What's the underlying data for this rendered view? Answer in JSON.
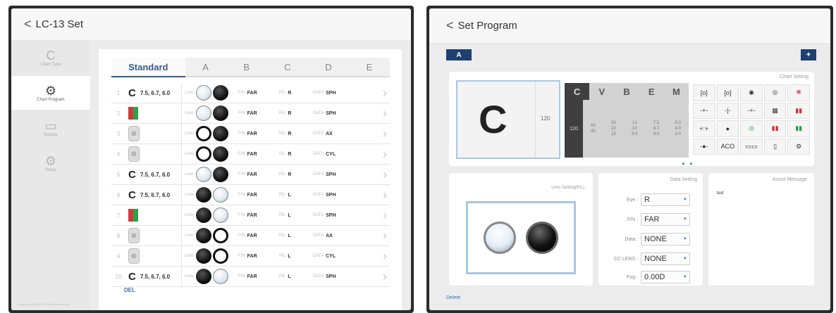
{
  "left": {
    "title": "LC-13 Set",
    "sidebar": [
      {
        "icon": "C",
        "label": "Chart Type",
        "active": false
      },
      {
        "icon": "⚙",
        "label": "Chart Program",
        "active": true
      },
      {
        "icon": "▭",
        "label": "Display",
        "active": false
      },
      {
        "icon": "⚙",
        "label": "Setup",
        "active": false
      }
    ],
    "tabs": [
      "Standard",
      "A",
      "B",
      "C",
      "D",
      "E"
    ],
    "rows": [
      {
        "num": "1",
        "chart": "C",
        "text": "7.5, 6.7, 6.0",
        "lens": "Lens",
        "l1": "white",
        "l2": "black",
        "fn_k": "F/N",
        "fn_v": "FAR",
        "rl_k": "R/L",
        "rl_v": "R",
        "data_k": "DATA",
        "data_v": "SPH"
      },
      {
        "num": "2",
        "chart": "rg",
        "text": "",
        "lens": "Lens",
        "l1": "white",
        "l2": "black",
        "fn_k": "F/N",
        "fn_v": "FAR",
        "rl_k": "R/L",
        "rl_v": "R",
        "data_k": "DATA",
        "data_v": "SPH"
      },
      {
        "num": "3",
        "chart": "fig",
        "text": "",
        "lens": "Lens",
        "l1": "ring",
        "l2": "black",
        "fn_k": "F/N",
        "fn_v": "FAR",
        "rl_k": "R/L",
        "rl_v": "R",
        "data_k": "DATA",
        "data_v": "AX"
      },
      {
        "num": "4",
        "chart": "fig",
        "text": "",
        "lens": "Lens",
        "l1": "ring",
        "l2": "black",
        "fn_k": "F/N",
        "fn_v": "FAR",
        "rl_k": "R/L",
        "rl_v": "R",
        "data_k": "DATA",
        "data_v": "CYL"
      },
      {
        "num": "5",
        "chart": "C",
        "text": "7.5, 6.7, 6.0",
        "lens": "Lens",
        "l1": "white",
        "l2": "black",
        "fn_k": "F/N",
        "fn_v": "FAR",
        "rl_k": "R/L",
        "rl_v": "R",
        "data_k": "DATA",
        "data_v": "SPH"
      },
      {
        "num": "6",
        "chart": "C",
        "text": "7.5, 6.7, 6.0",
        "lens": "Lens",
        "l1": "black",
        "l2": "white",
        "fn_k": "F/N",
        "fn_v": "FAR",
        "rl_k": "R/L",
        "rl_v": "L",
        "data_k": "DATA",
        "data_v": "SPH"
      },
      {
        "num": "7",
        "chart": "rg",
        "text": "",
        "lens": "Lens",
        "l1": "black",
        "l2": "white",
        "fn_k": "F/N",
        "fn_v": "FAR",
        "rl_k": "R/L",
        "rl_v": "L",
        "data_k": "DATA",
        "data_v": "SPH"
      },
      {
        "num": "8",
        "chart": "fig",
        "text": "",
        "lens": "Lens",
        "l1": "black",
        "l2": "ring",
        "fn_k": "F/N",
        "fn_v": "FAR",
        "rl_k": "R/L",
        "rl_v": "L",
        "data_k": "DATA",
        "data_v": "AX"
      },
      {
        "num": "9",
        "chart": "fig",
        "text": "",
        "lens": "Lens",
        "l1": "black",
        "l2": "ring",
        "fn_k": "F/N",
        "fn_v": "FAR",
        "rl_k": "R/L",
        "rl_v": "L",
        "data_k": "DATA",
        "data_v": "CYL"
      },
      {
        "num": "10",
        "chart": "C",
        "text": "7.5, 6.7, 6.0",
        "lens": "Lens",
        "l1": "black",
        "l2": "white",
        "fn_k": "F/N",
        "fn_v": "FAR",
        "rl_k": "R/L",
        "rl_v": "L",
        "data_k": "DATA",
        "data_v": "SPH"
      }
    ],
    "del_label": "DEL",
    "copyright": "Copyright (c) LUNEAU. All rights reserved."
  },
  "right": {
    "title": "Set Program",
    "program_button": "A",
    "plus_button": "+",
    "chart_setting_label": "Chart Setting",
    "preview_letter": "C",
    "preview_number": "120",
    "acuity_headers": [
      "C",
      "V",
      "B",
      "E",
      "M"
    ],
    "acuity_selected": "120",
    "acuity_cols": [
      [
        "60",
        "40"
      ],
      [
        "30",
        "20",
        "15"
      ],
      [
        "12",
        "10",
        "8.0"
      ],
      [
        "7.5",
        "6.7",
        "6.0"
      ],
      [
        "5.0",
        "4.0",
        "3.0"
      ]
    ],
    "icon_grid": [
      "[o]",
      "[o]",
      "◉",
      "◎",
      "❋",
      "-+-",
      "-|-",
      "-+-",
      "▦",
      "▮▮",
      "+:+",
      "●",
      "◎",
      "▮▮",
      "▮▮",
      "-●-",
      "ACO",
      "▭▭",
      "▯",
      "⚙"
    ],
    "lens_setting_label": "Lens Setting(R/L)",
    "data_setting_label": "Data Setting",
    "fields": [
      {
        "label": "Eye",
        "value": "R"
      },
      {
        "label": "F/N",
        "value": "FAR"
      },
      {
        "label": "Data",
        "value": "NONE"
      },
      {
        "label": "CC LENS",
        "value": "NONE"
      },
      {
        "label": "Fog",
        "value": "0.00D"
      }
    ],
    "assist_label": "Assist Message",
    "assist_message": "test",
    "delete_label": "Delete"
  }
}
